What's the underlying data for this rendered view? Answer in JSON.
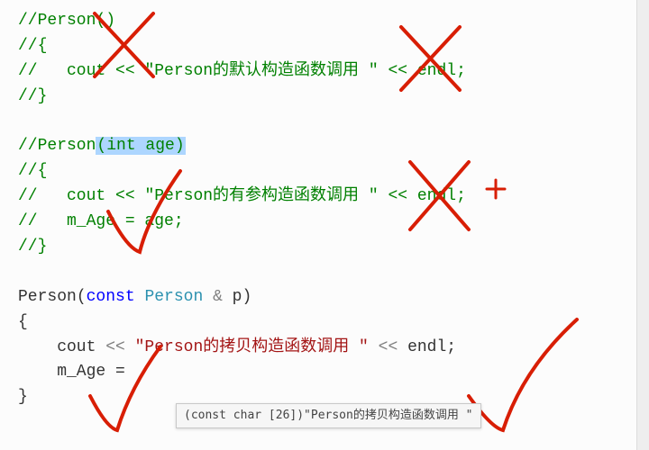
{
  "block1": {
    "l1": "//Person()",
    "l2": "//{",
    "l3_prefix": "//   cout ",
    "l3_op1": "<<",
    "l3_str": " \"Person的默认构造函数调用 \" ",
    "l3_op2": "<<",
    "l3_end": " endl;",
    "l4": "//}"
  },
  "block2": {
    "l1_prefix": "//Person",
    "l1_sel": "(int age)",
    "l2": "//{",
    "l3_prefix": "//   cout ",
    "l3_op1": "<<",
    "l3_str": " \"Person的有参构造函数调用 \" ",
    "l3_op2": "<<",
    "l3_end": " endl;",
    "l4": "//   m_Age = age;",
    "l5": "//}"
  },
  "block3": {
    "l1_name": "Person",
    "l1_open": "(",
    "l1_const": "const",
    "l1_type": " Person ",
    "l1_amp": "& ",
    "l1_param": "p",
    "l1_close": ")",
    "l2": "{",
    "l3_indent": "    cout ",
    "l3_op1": "<<",
    "l3_str": " \"Person的拷贝构造函数调用 \" ",
    "l3_op2": "<<",
    "l3_end": " endl;",
    "l4": "    m_Age = ",
    "l5": "}"
  },
  "tooltip": "(const char [26])\"Person的拷贝构造函数调用 \"",
  "annotation_color": "#d81e05"
}
